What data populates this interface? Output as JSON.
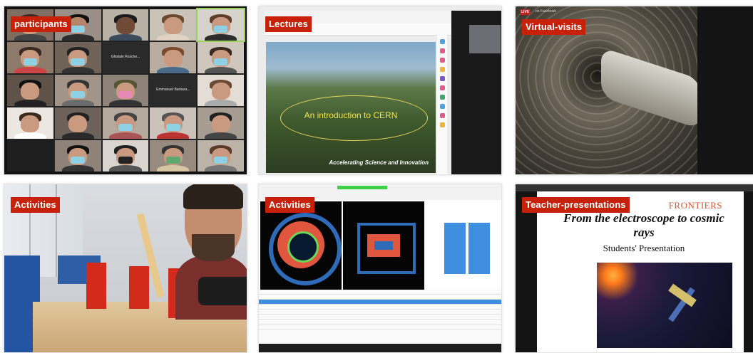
{
  "tiles": [
    {
      "label": "participants"
    },
    {
      "label": "Lectures"
    },
    {
      "label": "Virtual-visits"
    },
    {
      "label": "Activities"
    },
    {
      "label": "Activities"
    },
    {
      "label": "Teacher-presentations"
    }
  ],
  "participants": {
    "name_tiles": [
      "Ghislain Rosche...",
      "Emmanuel Barbara..."
    ]
  },
  "lecture": {
    "slide_title": "An introduction to CERN",
    "slide_tagline": "Accelerating Science and Innovation"
  },
  "virtual_visit": {
    "live_badge": "LIVE",
    "live_text": "on Facebook"
  },
  "teacher_presentation": {
    "logo": "FRONTIERS",
    "title": "From the electroscope to cosmic rays",
    "subtitle": "Students' Presentation"
  },
  "colors": {
    "label_bg": "#c8210a",
    "label_text": "#ffffff"
  }
}
